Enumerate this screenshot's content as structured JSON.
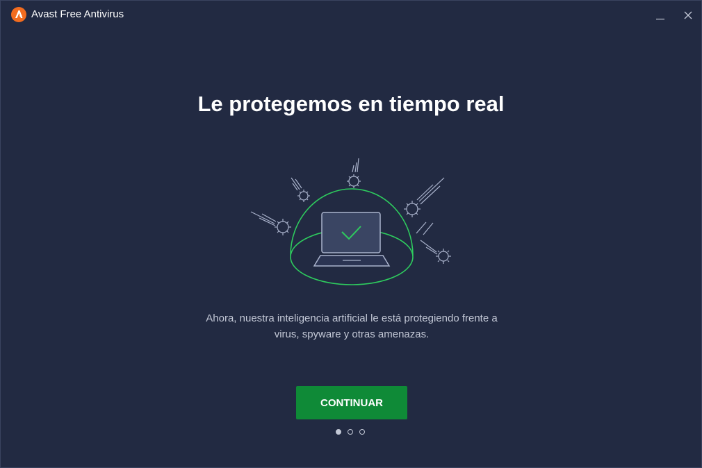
{
  "window": {
    "title": "Avast Free Antivirus"
  },
  "main": {
    "headline": "Le protegemos en tiempo real",
    "description_line1": "Ahora, nuestra inteligencia artificial le está protegiendo frente a",
    "description_line2": "virus, spyware y otras amenazas.",
    "continue_label": "CONTINUAR"
  },
  "pager": {
    "total": 3,
    "current": 1
  },
  "icons": {
    "logo": "avast-logo-icon",
    "minimize": "minimize-icon",
    "close": "close-icon",
    "illustration": "shield-dome-laptop-icon"
  },
  "colors": {
    "background": "#222a42",
    "accent_green": "#0f8a37",
    "dome_green": "#2ecc5e",
    "logo_orange": "#f26c1f"
  }
}
